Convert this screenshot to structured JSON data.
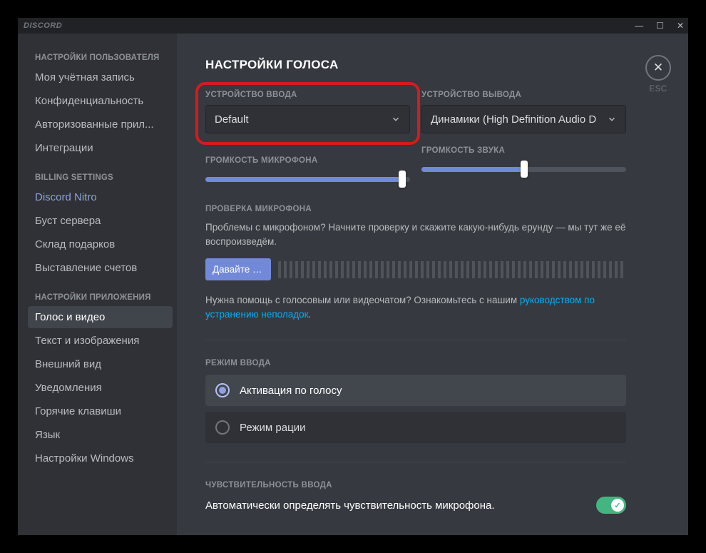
{
  "titlebar": {
    "app_name": "DISCORD"
  },
  "close": {
    "esc": "ESC"
  },
  "sidebar": {
    "sections": [
      {
        "header": "НАСТРОЙКИ ПОЛЬЗОВАТЕЛЯ",
        "items": [
          {
            "key": "account",
            "label": "Моя учётная запись"
          },
          {
            "key": "privacy",
            "label": "Конфиденциальность"
          },
          {
            "key": "authorized",
            "label": "Авторизованные прил..."
          },
          {
            "key": "integrations",
            "label": "Интеграции"
          }
        ]
      },
      {
        "header": "BILLING SETTINGS",
        "items": [
          {
            "key": "nitro",
            "label": "Discord Nitro",
            "nitro": true
          },
          {
            "key": "boost",
            "label": "Буст сервера"
          },
          {
            "key": "gifts",
            "label": "Склад подарков"
          },
          {
            "key": "billing",
            "label": "Выставление счетов"
          }
        ]
      },
      {
        "header": "НАСТРОЙКИ ПРИЛОЖЕНИЯ",
        "items": [
          {
            "key": "voice",
            "label": "Голос и видео",
            "active": true
          },
          {
            "key": "text",
            "label": "Текст и изображения"
          },
          {
            "key": "appearance",
            "label": "Внешний вид"
          },
          {
            "key": "notifications",
            "label": "Уведомления"
          },
          {
            "key": "keybinds",
            "label": "Горячие клавиши"
          },
          {
            "key": "language",
            "label": "Язык"
          },
          {
            "key": "windows",
            "label": "Настройки Windows"
          }
        ]
      }
    ]
  },
  "main": {
    "title": "НАСТРОЙКИ ГОЛОСА",
    "input_device": {
      "label": "УСТРОЙСТВО ВВОДА",
      "value": "Default"
    },
    "output_device": {
      "label": "УСТРОЙСТВО ВЫВОДА",
      "value": "Динамики (High Definition Audio D"
    },
    "input_volume": {
      "label": "ГРОМКОСТЬ МИКРОФОНА",
      "percent": 96
    },
    "output_volume": {
      "label": "ГРОМКОСТЬ ЗВУКА",
      "percent": 50
    },
    "mic_test": {
      "title": "ПРОВЕРКА МИКРОФОНА",
      "desc": "Проблемы с микрофоном? Начните проверку и скажите какую-нибудь ерунду — мы тут же её воспроизведём.",
      "button": "Давайте пр..."
    },
    "help": {
      "prefix": "Нужна помощь с голосовым или видеочатом? Ознакомьтесь с нашим ",
      "link": "руководством по устранению неполадок",
      "suffix": "."
    },
    "input_mode": {
      "title": "РЕЖИМ ВВОДА",
      "options": [
        {
          "key": "voice-activity",
          "label": "Активация по голосу",
          "selected": true
        },
        {
          "key": "ptt",
          "label": "Режим рации",
          "selected": false
        }
      ]
    },
    "sensitivity": {
      "title": "ЧУВСТВИТЕЛЬНОСТЬ ВВОДА",
      "toggle_label": "Автоматически определять чувствительность микрофона.",
      "toggle_on": true
    }
  }
}
